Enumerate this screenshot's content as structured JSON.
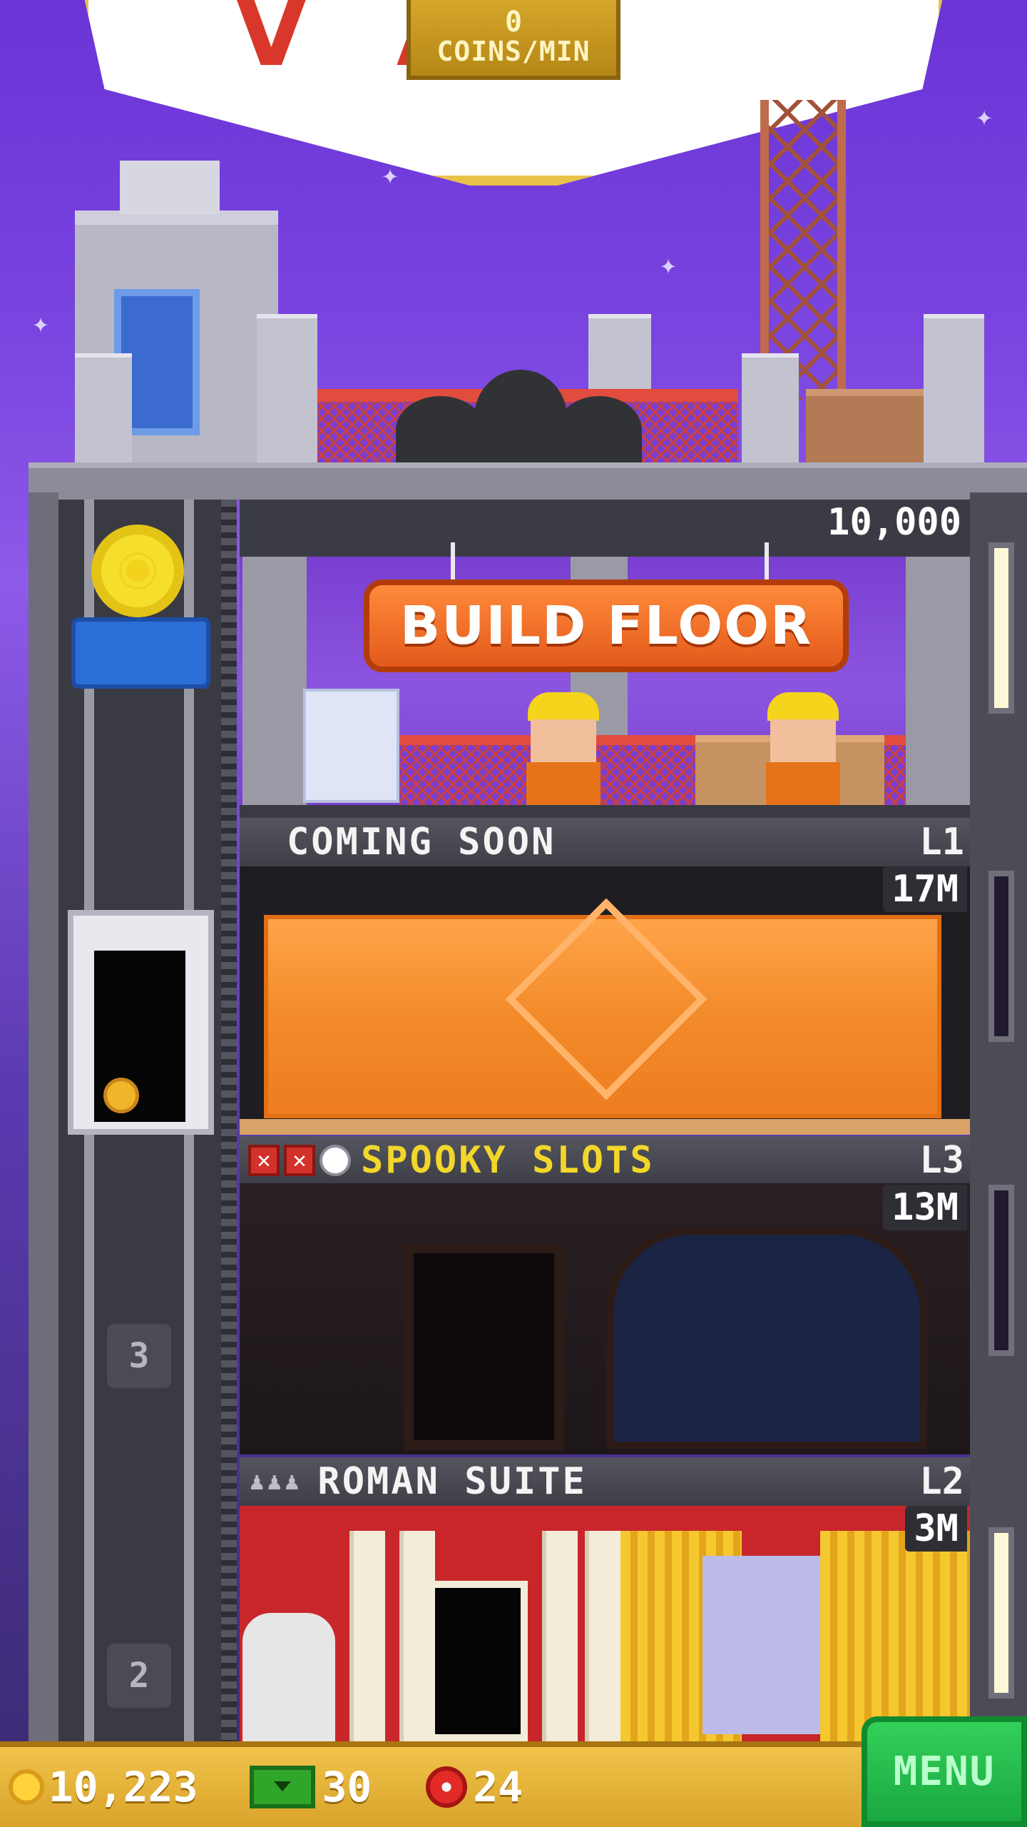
{
  "sign": {
    "coins_per_min_value": "0",
    "coins_per_min_label": "COINS/MIN"
  },
  "floors": {
    "build": {
      "price": "10,000",
      "button_label": "BUILD FLOOR"
    },
    "coming_soon": {
      "name": "COMING SOON",
      "level": "L1",
      "price": "17M"
    },
    "spooky_slots": {
      "name": "SPOOKY SLOTS",
      "level": "L3",
      "price": "13M",
      "status_icons": [
        "x-icon",
        "x-icon",
        "clock-icon"
      ]
    },
    "roman_suite": {
      "name": "ROMAN SUITE",
      "level": "L2",
      "price": "3M",
      "resident_icons": [
        "person-icon",
        "person-icon",
        "person-icon"
      ]
    }
  },
  "elevator": {
    "floor_numbers": [
      "3",
      "2"
    ]
  },
  "bottom_bar": {
    "coins": "10,223",
    "tower_bux": "30",
    "tokens": "24",
    "menu_label": "MENU"
  },
  "colors": {
    "sky": "#7a44e0",
    "build_button": "#e35a1c",
    "menu_button": "#1aa840",
    "spooky_title": "#f2d72a",
    "bottom_bar": "#e6b43a"
  }
}
